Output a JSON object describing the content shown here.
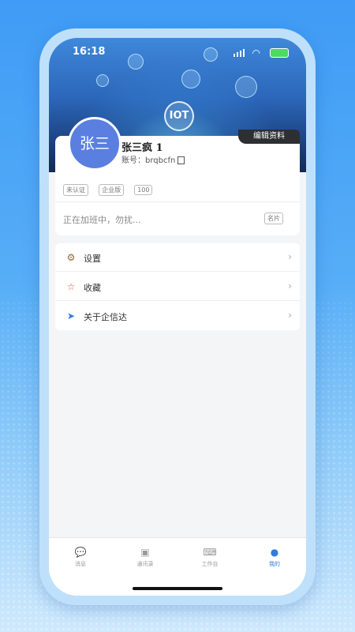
{
  "status_bar": {
    "time": "16:18"
  },
  "banner": {
    "badge": "IOT"
  },
  "profile": {
    "avatar_text": "张三",
    "edit_label": "编辑资料",
    "name": "张三疯 1",
    "account_label": "账号：",
    "account_value": "brqbcfn",
    "tags": [
      "未认证",
      "企业版",
      "100"
    ],
    "signature": "正在加班中，勿扰...",
    "card_button": "名片"
  },
  "menu": [
    {
      "icon": "gear-icon",
      "label": "设置"
    },
    {
      "icon": "star-icon",
      "label": "收藏"
    },
    {
      "icon": "send-icon",
      "label": "关于企信达"
    }
  ],
  "tabbar": [
    {
      "icon": "chat-icon",
      "label": "消息"
    },
    {
      "icon": "contacts-icon",
      "label": "通讯录"
    },
    {
      "icon": "keyboard-icon",
      "label": "工作台"
    },
    {
      "icon": "person-icon",
      "label": "我的",
      "active": true
    }
  ],
  "colors": {
    "accent": "#2f7be0",
    "avatar": "#5a7fe0",
    "background": "#3f9bf5"
  }
}
